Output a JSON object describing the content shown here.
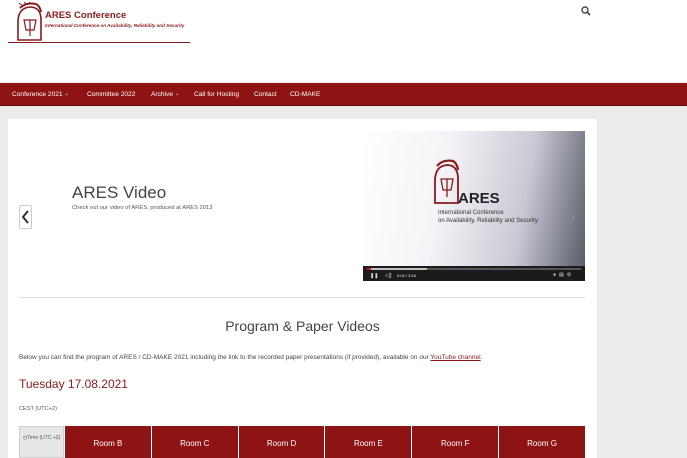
{
  "header": {
    "logo_title": "ARES Conference",
    "logo_subtitle": "International Conference on Availability, Reliability and Security",
    "search_icon": "search-icon"
  },
  "nav": {
    "items": [
      {
        "label": "Conference 2021",
        "has_dropdown": true
      },
      {
        "label": "Committee 2022",
        "has_dropdown": false
      },
      {
        "label": "Archive",
        "has_dropdown": true
      },
      {
        "label": "Call for Hosting",
        "has_dropdown": false
      },
      {
        "label": "Contact",
        "has_dropdown": false
      },
      {
        "label": "CD-MAKE",
        "has_dropdown": false
      }
    ],
    "color": "#8e1313"
  },
  "slider": {
    "title": "ARES Video",
    "caption": "Check out our video of ARES, produced at ARES 2013",
    "prev_icon": "chevron-left-icon"
  },
  "video": {
    "logo_text": "ARES",
    "subtitle_line1": "International Conference",
    "subtitle_line2": "on Availability, Reliability and Security",
    "time": "0:04 / 3:16",
    "progress_fraction": 0.28
  },
  "section": {
    "title": "Program & Paper Videos",
    "intro_before": "Below you can find the program of ARES / CD-MAKE 2021 including the link to the recorded paper presentations (if provided), available on our ",
    "intro_link": "YouTube channel",
    "intro_after": ".",
    "day": "Tuesday 17.08.2021",
    "timezone": "CEST (UTC+2)"
  },
  "table": {
    "time_header": "Time (UTC +2)",
    "rooms": [
      "Room B",
      "Room C",
      "Room D",
      "Room E",
      "Room F",
      "Room G"
    ]
  },
  "colors": {
    "accent": "#8b1a1a",
    "background": "#ececec"
  }
}
